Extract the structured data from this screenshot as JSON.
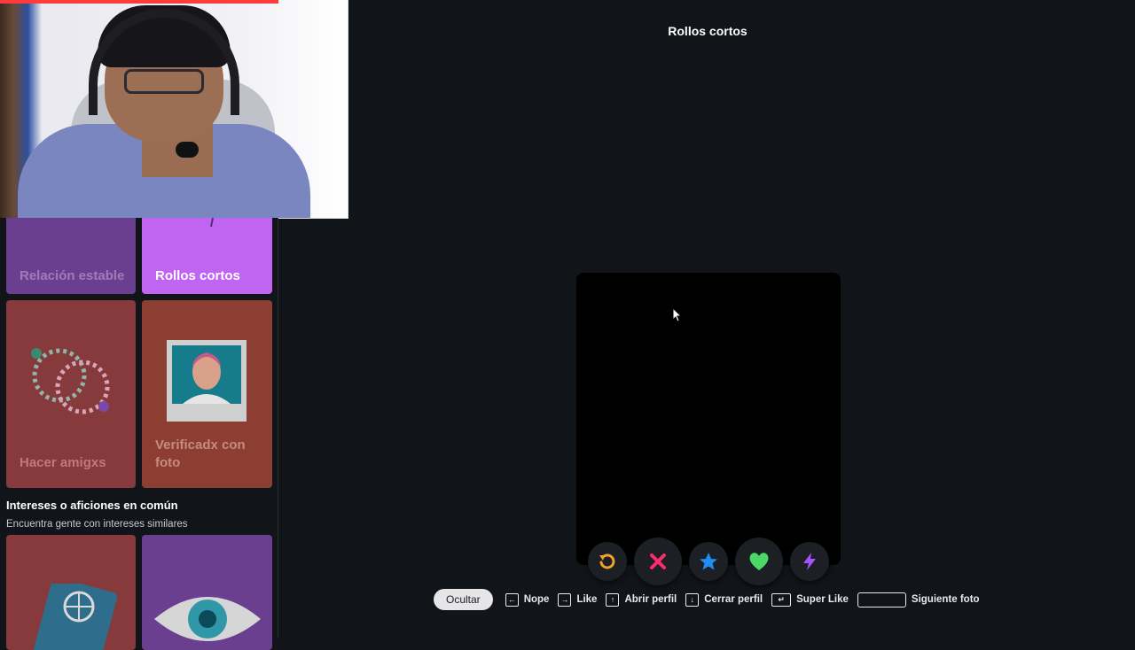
{
  "header": {
    "title": "Rollos cortos"
  },
  "explore": {
    "tiles_top": [
      {
        "label": "Relación estable"
      },
      {
        "label": "Rollos cortos"
      },
      {
        "label": "Hacer amigxs"
      },
      {
        "label": "Verificadx con foto"
      }
    ],
    "section": {
      "title": "Intereses o aficiones en común",
      "subtitle": "Encuentra gente con intereses similares"
    }
  },
  "actions": [
    {
      "icon": "rewind-icon",
      "color": "#f0a22a"
    },
    {
      "icon": "nope-x-icon",
      "color": "#ff2a6d"
    },
    {
      "icon": "super-like-star-icon",
      "color": "#1f8ef1"
    },
    {
      "icon": "like-heart-icon",
      "color": "#4bd866"
    },
    {
      "icon": "boost-bolt-icon",
      "color": "#a652ff"
    }
  ],
  "shortcuts": {
    "hide_label": "Ocultar",
    "items": [
      {
        "label": "Nope"
      },
      {
        "label": "Like"
      },
      {
        "label": "Abrir perfil"
      },
      {
        "label": "Cerrar perfil"
      },
      {
        "label": "Super Like"
      },
      {
        "label": "Siguiente foto"
      }
    ]
  },
  "colors": {
    "background": "#111418",
    "accent_purple": "#c064f2"
  },
  "video": {
    "progress": 0.8
  }
}
